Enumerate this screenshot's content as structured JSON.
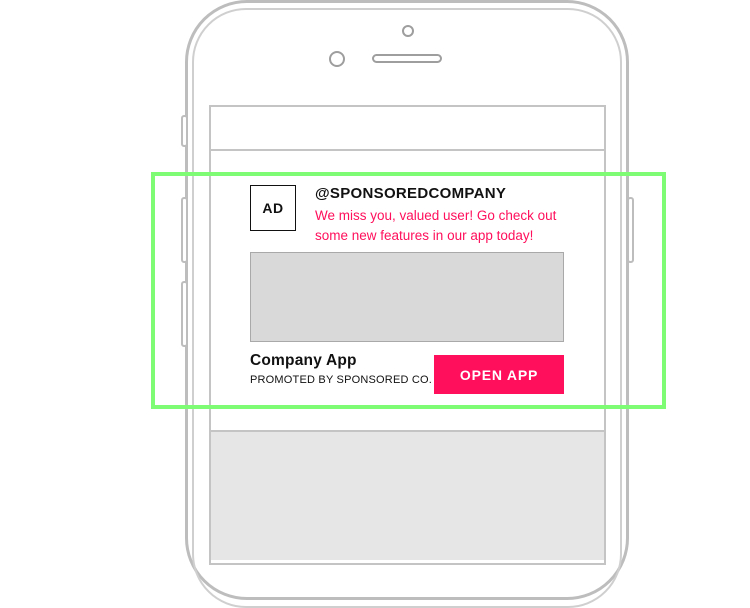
{
  "ad": {
    "badge": "AD",
    "handle": "@SPONSOREDCOMPANY",
    "message": "We miss you, valued user! Go check out some new features in our app today!",
    "app_name": "Company App",
    "promoted_by": "PROMOTED BY SPONSORED CO.",
    "cta_label": "OPEN APP"
  },
  "colors": {
    "accent": "#ff0f5c",
    "highlight": "#7dfc74",
    "media_placeholder": "#d9d9d9"
  }
}
